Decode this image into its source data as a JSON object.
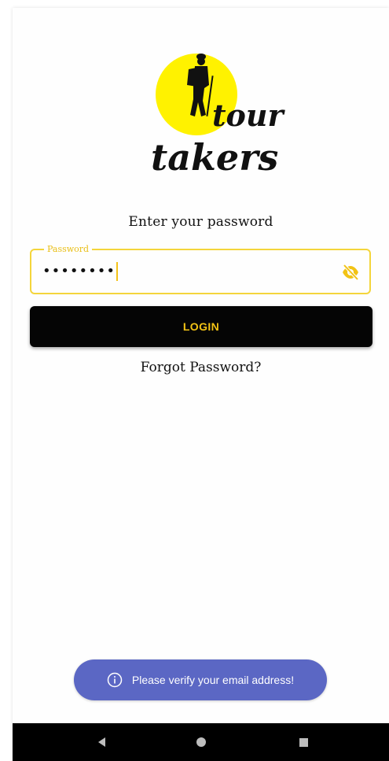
{
  "logo": {
    "line1": "tour",
    "line2": "takers",
    "sun_color": "#fff200"
  },
  "heading": "Enter your password",
  "password": {
    "label": "Password",
    "value": "••••••••",
    "toggle_icon": "eye-off-icon"
  },
  "login_button": "LOGIN",
  "forgot_link": "Forgot Password?",
  "toast": {
    "icon": "info-icon",
    "message": "Please verify your email address!"
  },
  "navbar": {
    "back_icon": "back-triangle-icon",
    "home_icon": "home-circle-icon",
    "recents_icon": "recents-square-icon"
  },
  "colors": {
    "accent": "#f4d53b",
    "button_bg": "#050505",
    "button_text": "#f2c315",
    "toast_bg": "#5b67c4"
  }
}
